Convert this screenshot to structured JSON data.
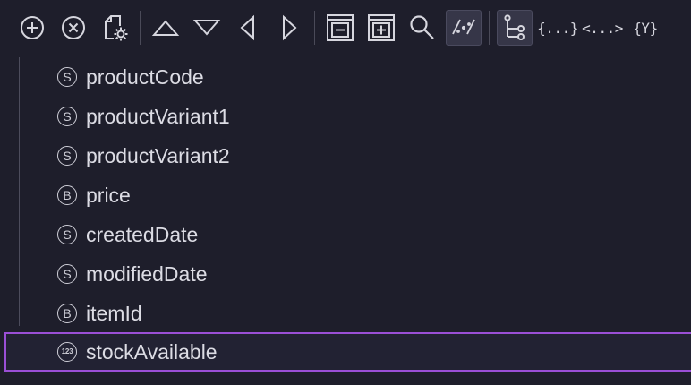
{
  "toolbar": {
    "buttons": [
      {
        "name": "add-button",
        "icon": "plus-circle-icon"
      },
      {
        "name": "remove-button",
        "icon": "x-circle-icon"
      },
      {
        "name": "file-settings-button",
        "icon": "file-gear-icon"
      },
      {
        "name": "move-up-button",
        "icon": "triangle-up-icon"
      },
      {
        "name": "move-down-button",
        "icon": "triangle-down-icon"
      },
      {
        "name": "move-left-button",
        "icon": "triangle-left-icon"
      },
      {
        "name": "move-right-button",
        "icon": "triangle-right-icon"
      },
      {
        "name": "collapse-all-button",
        "icon": "square-minus-icon"
      },
      {
        "name": "expand-all-button",
        "icon": "square-plus-icon"
      },
      {
        "name": "search-button",
        "icon": "magnifier-icon"
      },
      {
        "name": "regex-toggle-button",
        "icon": "regex-slash-icon",
        "active": true
      },
      {
        "name": "tree-view-button",
        "icon": "tree-branch-icon",
        "active": true
      },
      {
        "name": "json-view-button",
        "icon": "braces-icon",
        "label": "{...}"
      },
      {
        "name": "xml-view-button",
        "icon": "angle-brackets-icon",
        "label": "<...>"
      },
      {
        "name": "yaml-view-button",
        "icon": "yaml-braces-icon",
        "label": "{Y}"
      }
    ],
    "json_label": "{...}",
    "xml_label": "<...>",
    "yaml_label": "{Y}"
  },
  "tree": {
    "items": [
      {
        "label": "productCode",
        "type_badge": "S",
        "type": "string"
      },
      {
        "label": "productVariant1",
        "type_badge": "S",
        "type": "string"
      },
      {
        "label": "productVariant2",
        "type_badge": "S",
        "type": "string"
      },
      {
        "label": "price",
        "type_badge": "B",
        "type": "bigdecimal"
      },
      {
        "label": "createdDate",
        "type_badge": "S",
        "type": "string"
      },
      {
        "label": "modifiedDate",
        "type_badge": "S",
        "type": "string"
      },
      {
        "label": "itemId",
        "type_badge": "B",
        "type": "bigdecimal"
      },
      {
        "label": "stockAvailable",
        "type_badge": "123",
        "type": "number",
        "selected": true
      }
    ]
  },
  "colors": {
    "background": "#1e1e2b",
    "selection_border": "#9b4fd6",
    "text": "#dcdce4"
  }
}
